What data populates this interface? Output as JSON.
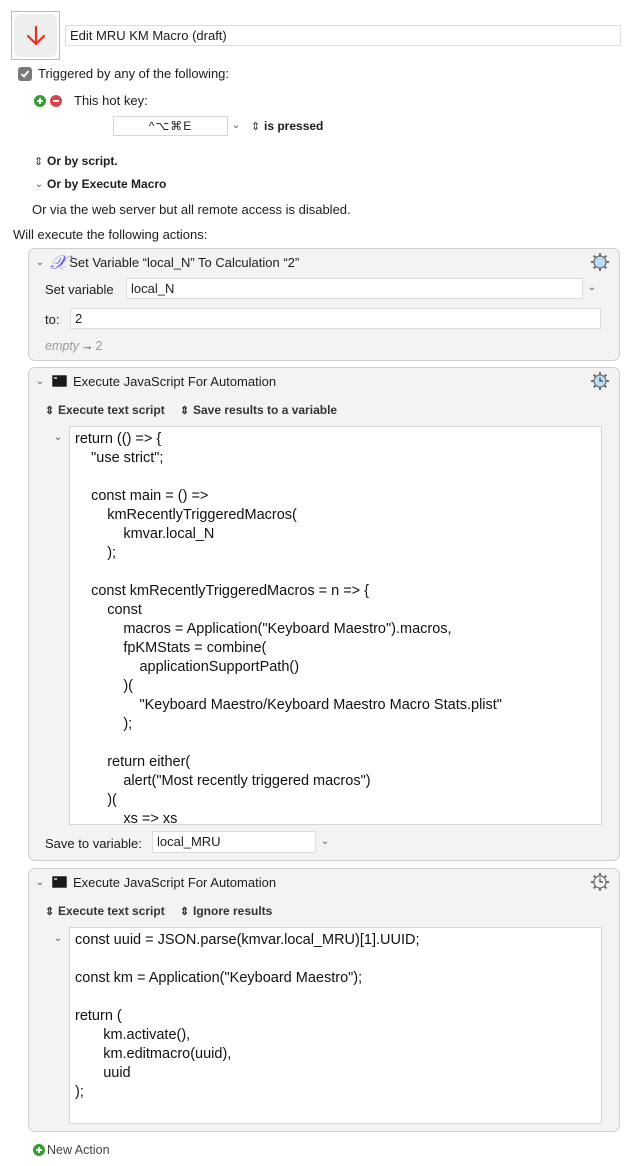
{
  "macro": {
    "title": "Edit MRU KM Macro (draft)",
    "icon": "red-down-arrow-icon"
  },
  "triggers": {
    "enabled_label": "Triggered by any of the following:",
    "enabled": true,
    "hotkey_label": "This hot key:",
    "hotkey_value": "^⌥⌘E",
    "hotkey_condition": "is pressed",
    "or_by_script": "Or by script.",
    "or_by_execute_macro": "Or by Execute Macro",
    "web_server_note": "Or via the web server but all remote access is disabled."
  },
  "actions_label": "Will execute the following actions:",
  "actions": [
    {
      "title": "Set Variable “local_N” To Calculation “2”",
      "icon": "variable-x-icon",
      "set_variable_label": "Set variable",
      "variable_name": "local_N",
      "to_label": "to:",
      "to_value": "2",
      "preview_prefix": "empty",
      "preview_arrow": "→",
      "preview_result": "2"
    },
    {
      "title": "Execute JavaScript For Automation",
      "icon": "terminal-icon",
      "execute_mode": "Execute text script",
      "result_mode": "Save results to a variable",
      "code": "return (() => {\n    \"use strict\";\n\n    const main = () =>\n        kmRecentlyTriggeredMacros(\n            kmvar.local_N\n        );\n\n    const kmRecentlyTriggeredMacros = n => {\n        const\n            macros = Application(\"Keyboard Maestro\").macros,\n            fpKMStats = combine(\n                applicationSupportPath()\n            )(\n                \"Keyboard Maestro/Keyboard Maestro Macro Stats.plist\"\n            );\n\n        return either(\n            alert(\"Most recently triggered macros\")\n        )(\n            xs => xs",
      "save_to_label": "Save to variable:",
      "save_to_value": "local_MRU"
    },
    {
      "title": "Execute JavaScript For Automation",
      "icon": "terminal-icon",
      "execute_mode": "Execute text script",
      "result_mode": "Ignore results",
      "code": "const uuid = JSON.parse(kmvar.local_MRU)[1].UUID;\n\nconst km = Application(\"Keyboard Maestro\");\n\nreturn (\n       km.activate(),\n       km.editmacro(uuid),\n       uuid\n);"
    }
  ],
  "new_action_label": "New Action",
  "colors": {
    "accent_red": "#e8321f",
    "add_green": "#3a9a3a",
    "remove_red": "#d0474d",
    "variable_purple": "#6b63e8",
    "gear_blue": "#b9dcf7"
  }
}
